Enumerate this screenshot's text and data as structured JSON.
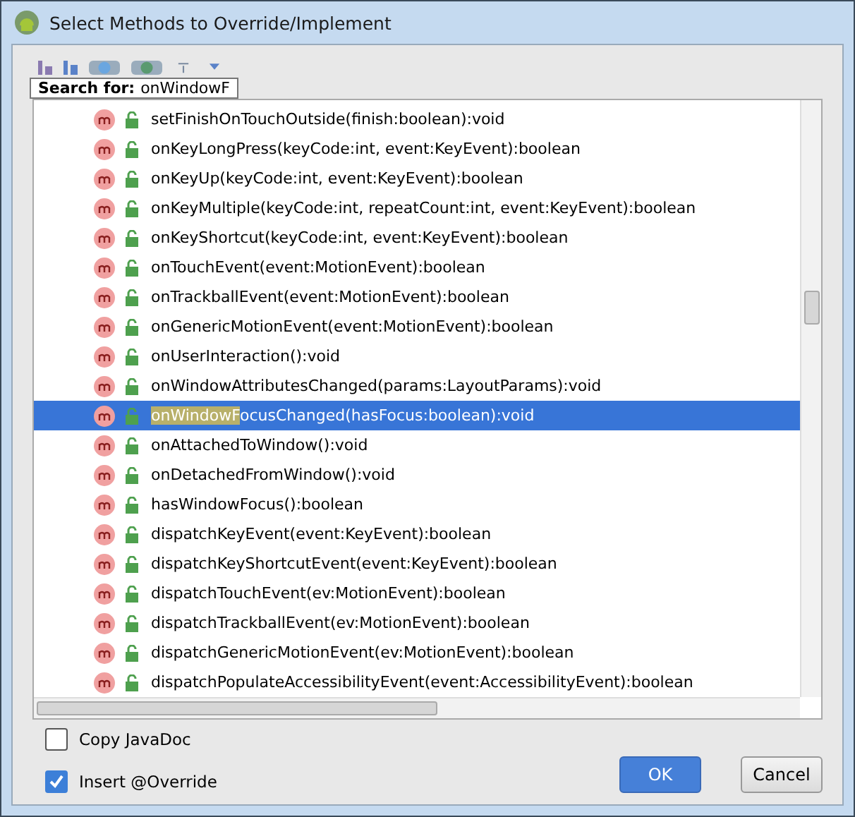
{
  "window": {
    "title": "Select Methods to Override/Implement"
  },
  "search": {
    "label": "Search for:",
    "value": "onWindowF"
  },
  "methods": [
    {
      "text": "setFinishOnTouchOutside(finish:boolean):void",
      "selected": false
    },
    {
      "text": "onKeyLongPress(keyCode:int, event:KeyEvent):boolean",
      "selected": false
    },
    {
      "text": "onKeyUp(keyCode:int, event:KeyEvent):boolean",
      "selected": false
    },
    {
      "text": "onKeyMultiple(keyCode:int, repeatCount:int, event:KeyEvent):boolean",
      "selected": false
    },
    {
      "text": "onKeyShortcut(keyCode:int, event:KeyEvent):boolean",
      "selected": false
    },
    {
      "text": "onTouchEvent(event:MotionEvent):boolean",
      "selected": false
    },
    {
      "text": "onTrackballEvent(event:MotionEvent):boolean",
      "selected": false
    },
    {
      "text": "onGenericMotionEvent(event:MotionEvent):boolean",
      "selected": false
    },
    {
      "text": "onUserInteraction():void",
      "selected": false
    },
    {
      "text": "onWindowAttributesChanged(params:LayoutParams):void",
      "selected": false
    },
    {
      "match": "onWindowF",
      "text": "ocusChanged(hasFocus:boolean):void",
      "selected": true
    },
    {
      "text": "onAttachedToWindow():void",
      "selected": false
    },
    {
      "text": "onDetachedFromWindow():void",
      "selected": false
    },
    {
      "text": "hasWindowFocus():boolean",
      "selected": false
    },
    {
      "text": "dispatchKeyEvent(event:KeyEvent):boolean",
      "selected": false
    },
    {
      "text": "dispatchKeyShortcutEvent(event:KeyEvent):boolean",
      "selected": false
    },
    {
      "text": "dispatchTouchEvent(ev:MotionEvent):boolean",
      "selected": false
    },
    {
      "text": "dispatchTrackballEvent(ev:MotionEvent):boolean",
      "selected": false
    },
    {
      "text": "dispatchGenericMotionEvent(ev:MotionEvent):boolean",
      "selected": false
    },
    {
      "text": "dispatchPopulateAccessibilityEvent(event:AccessibilityEvent):boolean",
      "selected": false
    }
  ],
  "options": [
    {
      "label": "Copy JavaDoc",
      "checked": false
    },
    {
      "label": "Insert @Override",
      "checked": true
    }
  ],
  "buttons": [
    {
      "label": "OK",
      "kind": "primary"
    },
    {
      "label": "Cancel",
      "kind": "secondary"
    }
  ]
}
